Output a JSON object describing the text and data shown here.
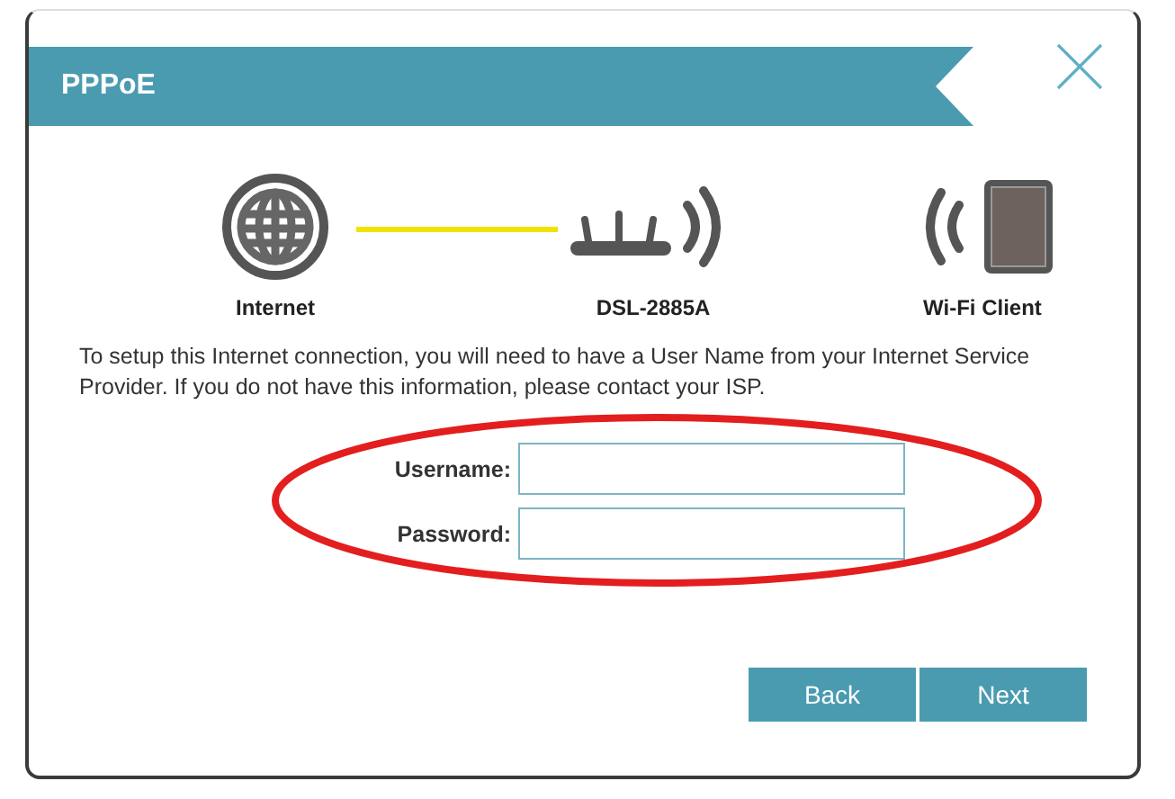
{
  "dialog": {
    "title": "PPPoE"
  },
  "diagram": {
    "nodes": [
      {
        "kind": "internet",
        "label": "Internet"
      },
      {
        "kind": "router",
        "label": "DSL-2885A"
      },
      {
        "kind": "client",
        "label": "Wi-Fi Client"
      }
    ]
  },
  "instructions": "To setup this Internet connection, you will need to have a User Name from your Internet Service Provider. If you do not have this information, please contact your ISP.",
  "fields": [
    {
      "label": "Username:"
    },
    {
      "label": "Password:"
    }
  ],
  "buttons": [
    "Back",
    "Next"
  ]
}
